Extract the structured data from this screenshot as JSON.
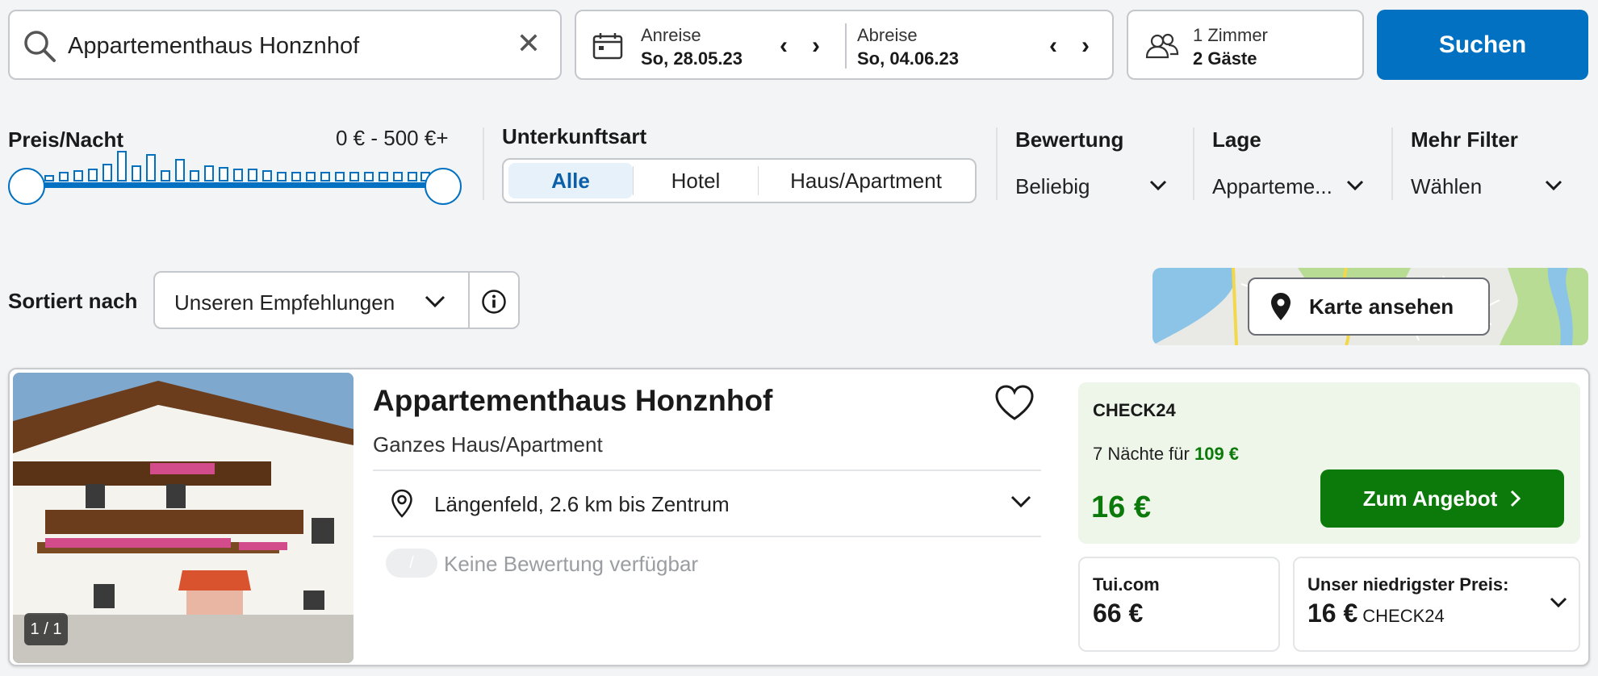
{
  "search": {
    "destination": "Appartementhaus Honznhof",
    "checkin_label": "Anreise",
    "checkin_value": "So, 28.05.23",
    "checkout_label": "Abreise",
    "checkout_value": "So, 04.06.23",
    "rooms": "1 Zimmer",
    "guests": "2 Gäste",
    "search_button": "Suchen"
  },
  "filters": {
    "price_title": "Preis/Nacht",
    "price_range": "0 € - 500 €+",
    "type_title": "Unterkunftsart",
    "type_options": [
      "Alle",
      "Hotel",
      "Haus/Apartment"
    ],
    "type_selected": "Alle",
    "rating_title": "Bewertung",
    "rating_value": "Beliebig",
    "location_title": "Lage",
    "location_value": "Apparteme...",
    "more_title": "Mehr Filter",
    "more_value": "Wählen"
  },
  "sort": {
    "label": "Sortiert nach",
    "value": "Unseren Empfehlungen"
  },
  "map": {
    "button": "Karte ansehen"
  },
  "result": {
    "name": "Appartementhaus Honznhof",
    "type": "Ganzes Haus/Apartment",
    "photo_counter": "1 / 1",
    "location": "Längenfeld, 2.6 km bis Zentrum",
    "rating_badge": "/",
    "rating_text": "Keine Bewertung verfügbar",
    "offer": {
      "provider": "CHECK24",
      "nights_text": "7 Nächte für",
      "total_price": "109 €",
      "price_per_night": "16 €",
      "button": "Zum Angebot"
    },
    "alt_offer": {
      "provider": "Tui.com",
      "price": "66 €"
    },
    "lowest": {
      "label": "Unser niedrigster Preis:",
      "price": "16 €",
      "provider": "CHECK24"
    }
  },
  "colors": {
    "brand_blue": "#0271c2",
    "offer_green": "#0b7a0b",
    "offer_bg": "#eef5e9"
  }
}
